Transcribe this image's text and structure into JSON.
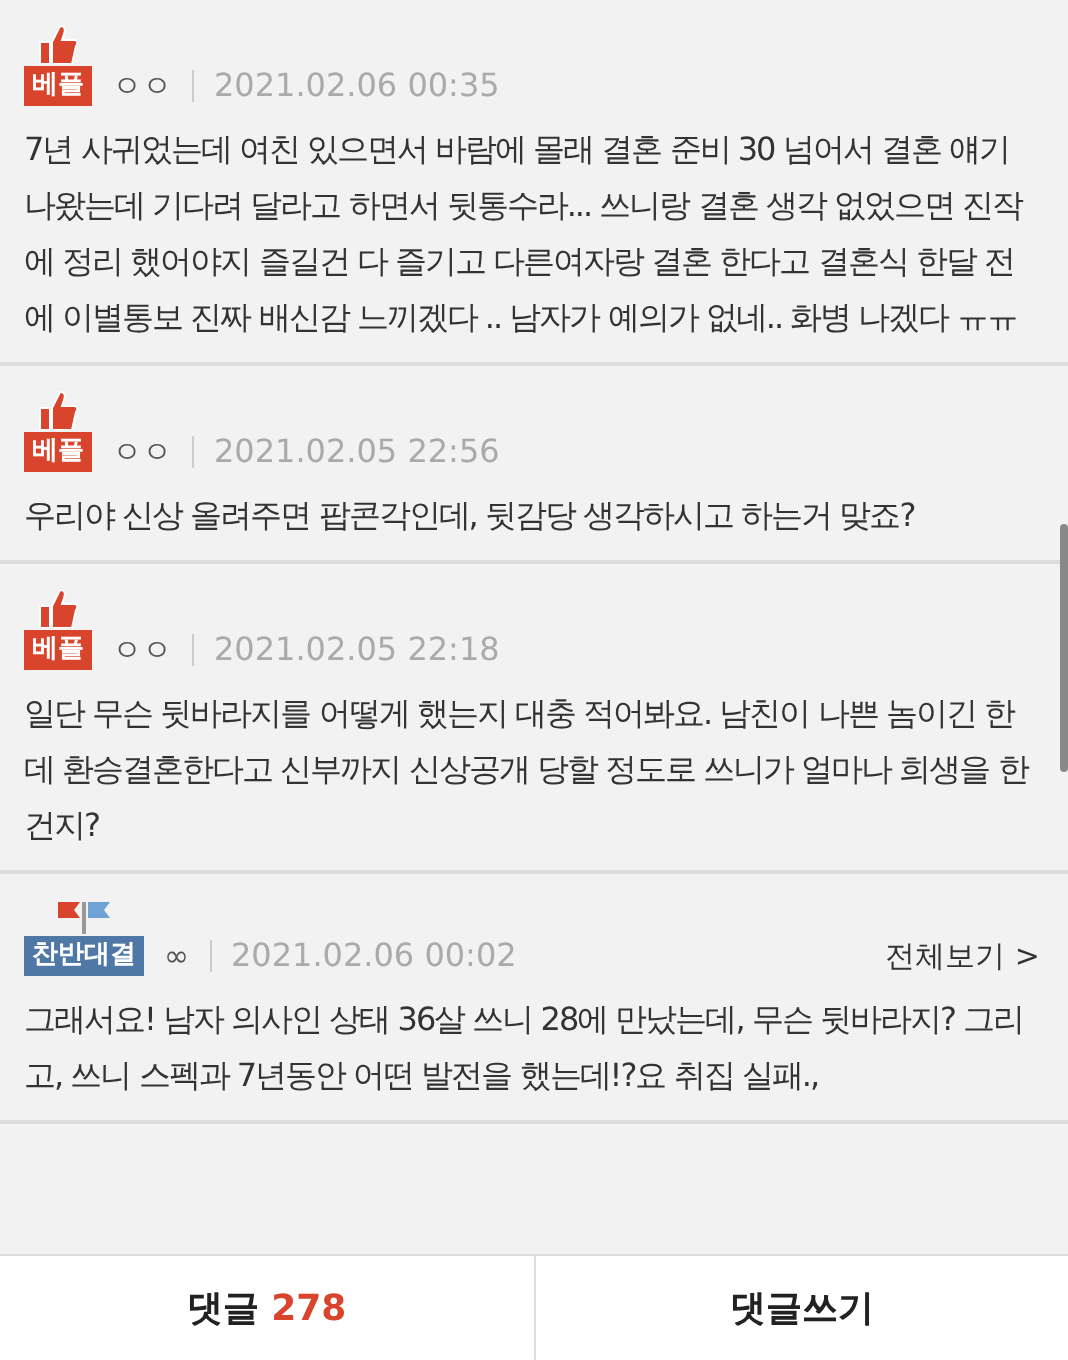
{
  "comments": [
    {
      "badge": {
        "kind": "best",
        "label": "베플"
      },
      "author": "ㅇㅇ",
      "date": "2021.02.06 00:35",
      "body": "7년 사귀었는데 여친 있으면서 바람에 몰래 결혼 준비 30 넘어서 결혼 얘기 나왔는데 기다려 달라고 하면서 뒷통수라... 쓰니랑 결혼 생각 없었으면 진작에 정리 했어야지 즐길건 다 즐기고 다른여자랑 결혼 한다고 결혼식 한달 전에 이별통보 진짜 배신감 느끼겠다 .. 남자가 예의가 없네.. 화병 나겠다 ㅠㅠ"
    },
    {
      "badge": {
        "kind": "best",
        "label": "베플"
      },
      "author": "ㅇㅇ",
      "date": "2021.02.05 22:56",
      "body": "우리야 신상 올려주면 팝콘각인데, 뒷감당 생각하시고 하는거 맞죠?"
    },
    {
      "badge": {
        "kind": "best",
        "label": "베플"
      },
      "author": "ㅇㅇ",
      "date": "2021.02.05 22:18",
      "body": "일단 무슨 뒷바라지를 어떻게 했는지 대충 적어봐요. 남친이 나쁜 놈이긴 한데 환승결혼한다고 신부까지 신상공개 당할 정도로 쓰니가 얼마나 희생을 한건지?"
    },
    {
      "badge": {
        "kind": "debate",
        "label": "찬반대결"
      },
      "author": "∞",
      "date": "2021.02.06 00:02",
      "more_link": "전체보기 >",
      "body": "그래서요! 남자 의사인 상태 36살 쓰니 28에 만났는데, 무슨 뒷바라지? 그리고, 쓰니 스펙과 7년동안 어떤 발전을 했는데!?요 취집 실패.,"
    }
  ],
  "bottom_bar": {
    "comments_label": "댓글",
    "comments_count": "278",
    "write_label": "댓글쓰기"
  }
}
